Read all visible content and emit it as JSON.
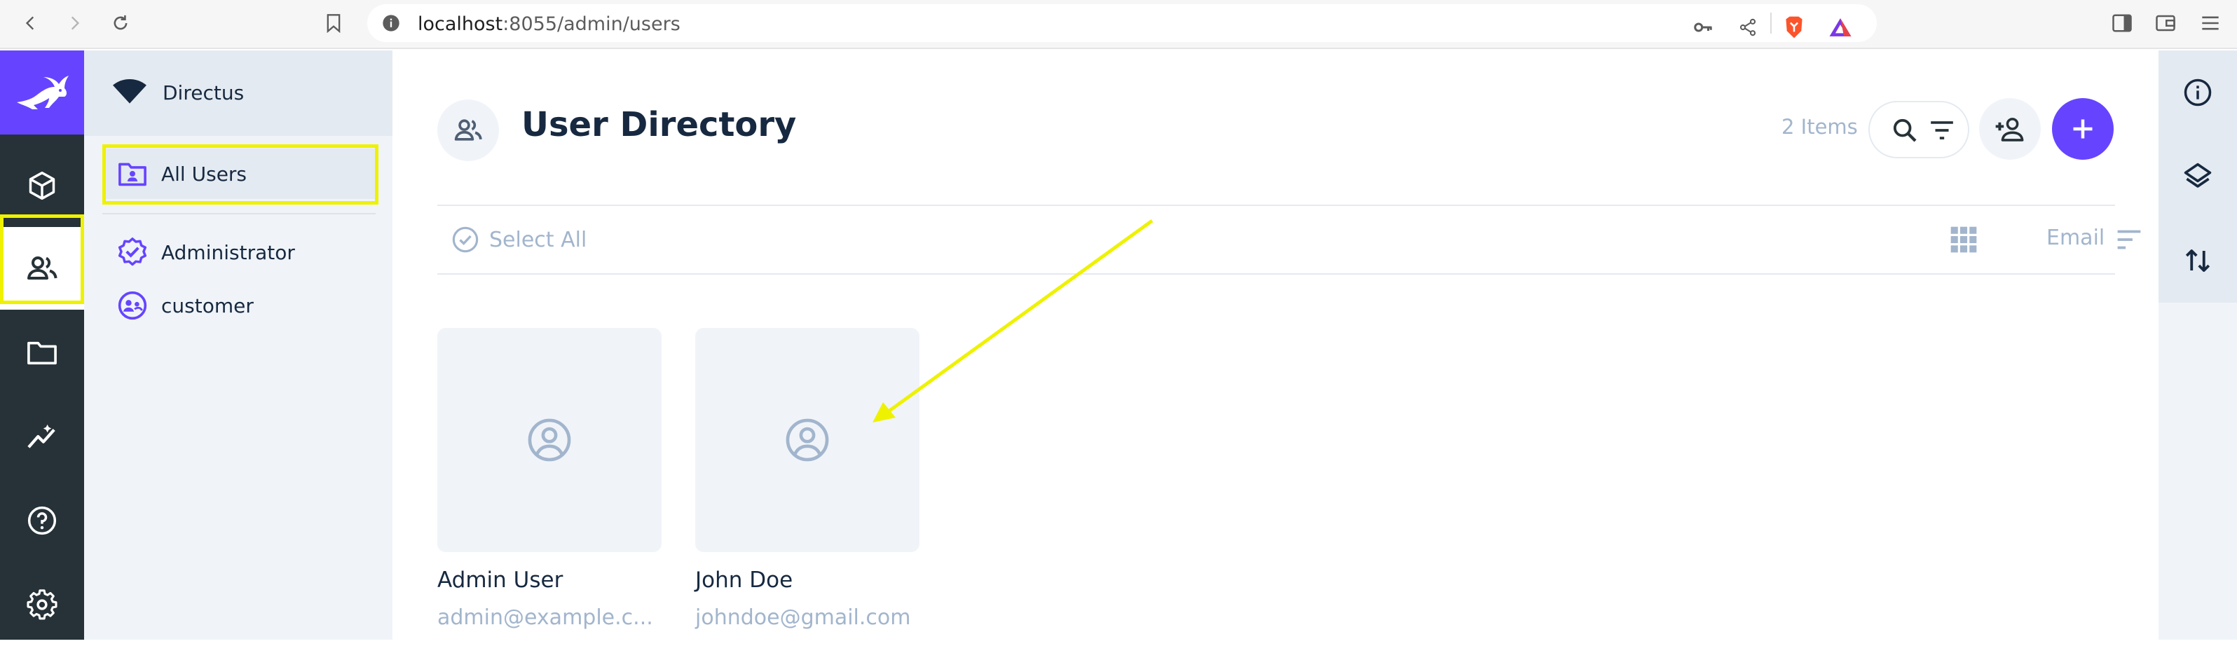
{
  "browser": {
    "url_host": "localhost",
    "url_path": ":8055/admin/users"
  },
  "project": {
    "name": "Directus"
  },
  "navigation": {
    "items": [
      {
        "label": "All Users",
        "icon": "folder-user-icon",
        "active": true
      },
      {
        "label": "Administrator",
        "icon": "verified-badge-icon",
        "active": false
      },
      {
        "label": "customer",
        "icon": "supervised-user-icon",
        "active": false
      }
    ]
  },
  "header": {
    "title": "User Directory",
    "item_count": "2 Items"
  },
  "toolbar": {
    "select_all": "Select All",
    "sort_field": "Email"
  },
  "cards": [
    {
      "name": "Admin User",
      "email": "admin@example.c..."
    },
    {
      "name": "John Doe",
      "email": "johndoe@gmail.com"
    }
  ],
  "colors": {
    "brand": "#6644ff",
    "rail": "#263238",
    "highlight": "#eef200",
    "muted_text": "#a2b5cd"
  }
}
